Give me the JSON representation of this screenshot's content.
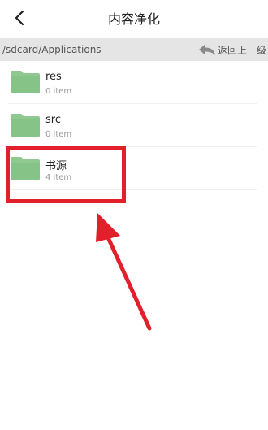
{
  "header": {
    "title": "内容净化"
  },
  "pathbar": {
    "path": "/sdcard/Applications",
    "up_label": "返回上一级"
  },
  "folders": [
    {
      "name": "res",
      "count": "0 item"
    },
    {
      "name": "src",
      "count": "0 item"
    },
    {
      "name": "书源",
      "count": "4 item"
    }
  ],
  "colors": {
    "folder": "#8fc98f",
    "annotation": "#e2202b"
  },
  "icons": {
    "back": "chevron-left-icon",
    "up": "reply-arrow-icon",
    "folder": "folder-icon"
  }
}
